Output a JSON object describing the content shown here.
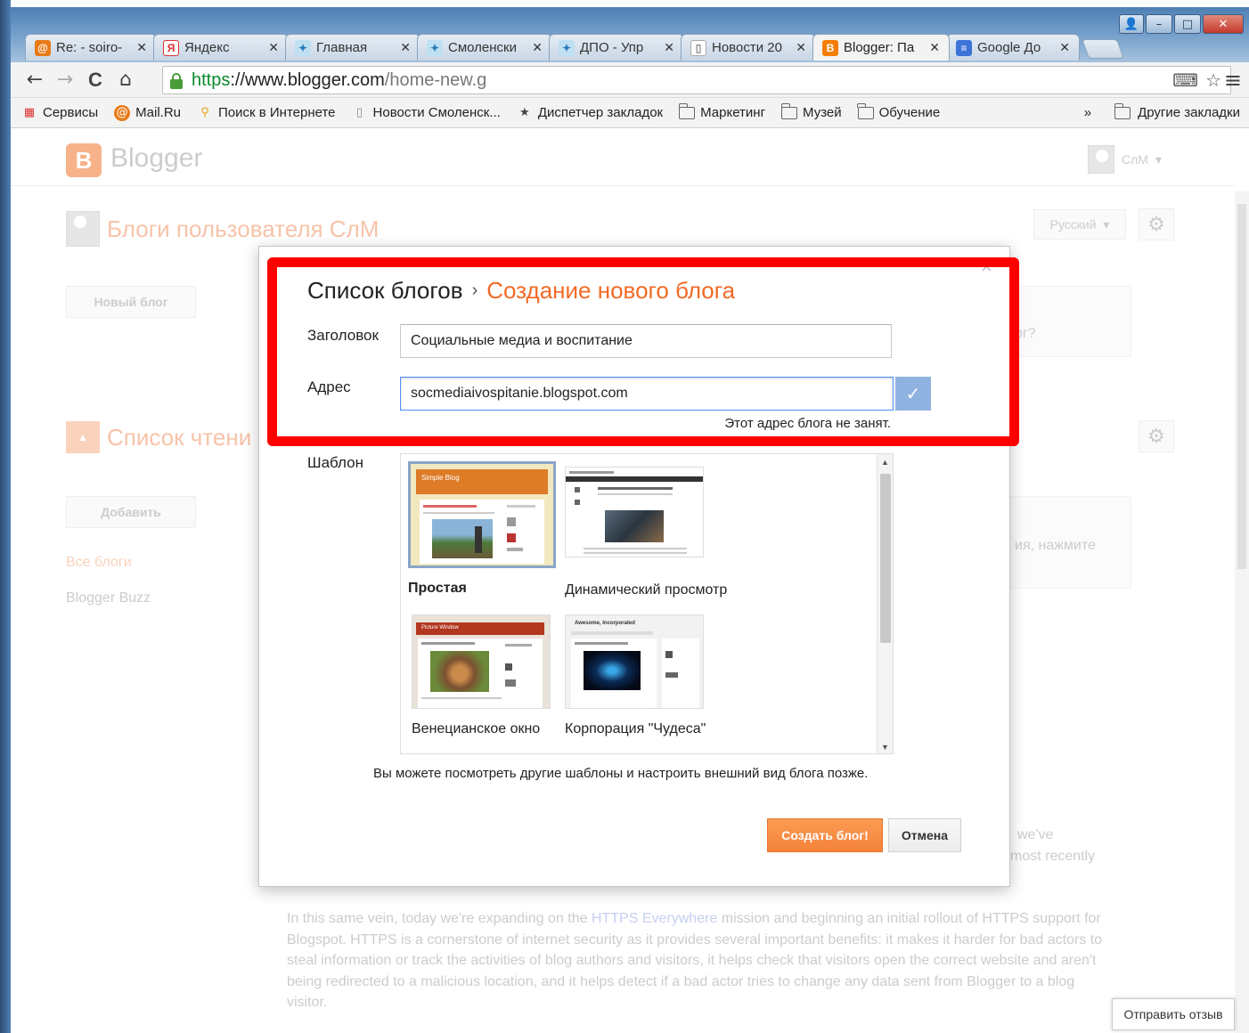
{
  "window": {
    "min_glyph": "–",
    "max_glyph": "□",
    "close_glyph": "✕",
    "user_glyph": "👤"
  },
  "tabs": [
    {
      "label": "Re: - soiro-",
      "icon_text": "@",
      "color": "#e87b19"
    },
    {
      "label": "Яндекс",
      "icon_text": "Я",
      "color": "#d33"
    },
    {
      "label": "Главная",
      "icon_text": "✦",
      "color": "#4aa0d8"
    },
    {
      "label": "Смоленски",
      "icon_text": "✦",
      "color": "#4aa0d8"
    },
    {
      "label": "ДПО - Упр",
      "icon_text": "✦",
      "color": "#4aa0d8"
    },
    {
      "label": "Новости 20",
      "icon_text": "▯",
      "color": "#999"
    },
    {
      "label": "Blogger: Па",
      "icon_text": "B",
      "color": "#f57d00",
      "active": true
    },
    {
      "label": "Google До",
      "icon_text": "≡",
      "color": "#3b73d9"
    }
  ],
  "tab_close_glyph": "✕",
  "toolbar": {
    "back": "←",
    "forward": "→",
    "reload": "C",
    "home": "⌂",
    "url_scheme": "https",
    "url_host": "://www.blogger.com",
    "url_path": "/home-new.g",
    "translate_icon": "⌨",
    "star_icon": "☆",
    "menu_icon": "≡"
  },
  "bookmarks": [
    {
      "label": "Сервисы",
      "icon": "apps-icon"
    },
    {
      "label": "Mail.Ru",
      "icon": "mailru-icon"
    },
    {
      "label": "Поиск в Интернете",
      "icon": "search-icon"
    },
    {
      "label": "Новости Смоленск...",
      "icon": "page-icon"
    },
    {
      "label": "Диспетчер закладок",
      "icon": "star-icon"
    },
    {
      "label": "Маркетинг",
      "icon": "folder-icon"
    },
    {
      "label": "Музей",
      "icon": "folder-icon"
    },
    {
      "label": "Обучение",
      "icon": "folder-icon"
    }
  ],
  "bookmarks_more": "»",
  "bookmarks_other": "Другие закладки",
  "background": {
    "app_name": "Blogger",
    "user_name": "СлМ",
    "user_caret": "▾",
    "blogs_title": "Блоги пользователя СлМ",
    "language": "Русский",
    "language_caret": "▾",
    "new_blog": "Новый блог",
    "reading_list": "Список чтени",
    "add": "Добавить",
    "all_blogs": "Все блоги",
    "blogger_buzz": "Blogger Buzz",
    "right_snip1": "ог?",
    "right_snip2": "ия, нажмите",
    "right_snip3": "we've",
    "right_snip4": "most recently",
    "news_p1": "In this same vein, today we're expanding on the ",
    "news_link": "HTTPS Everywhere",
    "news_p2": " mission and beginning an initial rollout of HTTPS support for Blogspot. HTTPS is a cornerstone of internet security as it provides several important benefits: it makes it harder for bad actors to steal information or track the activities of blog authors and visitors, it helps check that visitors open the correct website and aren't being redirected to a malicious location, and it helps detect if a bad actor tries to change any data sent from Blogger to a blog visitor.",
    "feedback": "Отправить отзыв"
  },
  "dialog": {
    "breadcrumb_root": "Список блогов",
    "breadcrumb_sep": "›",
    "breadcrumb_current": "Создание нового блога",
    "close": "×",
    "title_label": "Заголовок",
    "title_value": "Социальные медиа и воспитание",
    "address_label": "Адрес",
    "address_value": "socmediaivospitanie.blogspot.com",
    "check_glyph": "✓",
    "availability": "Этот адрес блога не занят.",
    "template_label": "Шаблон",
    "templates": [
      {
        "name": "Простая",
        "selected": true
      },
      {
        "name": "Динамический просмотр",
        "selected": false
      },
      {
        "name": "Венецианское окно",
        "selected": false
      },
      {
        "name": "Корпорация \"Чудеса\"",
        "selected": false
      }
    ],
    "thumb_simple_header": "Simple Blog",
    "thumb_venetian_header": "Picture Window",
    "thumb_awesome_header": "Awesome, Incorporated",
    "scroll_up": "▲",
    "scroll_down": "▼",
    "note": "Вы можете посмотреть другие шаблоны и настроить внешний вид блога позже.",
    "create": "Создать блог!",
    "cancel": "Отмена"
  },
  "colors": {
    "accent_orange": "#f16a25",
    "highlight_red": "#ff0000",
    "link_blue": "#4d90fe"
  }
}
